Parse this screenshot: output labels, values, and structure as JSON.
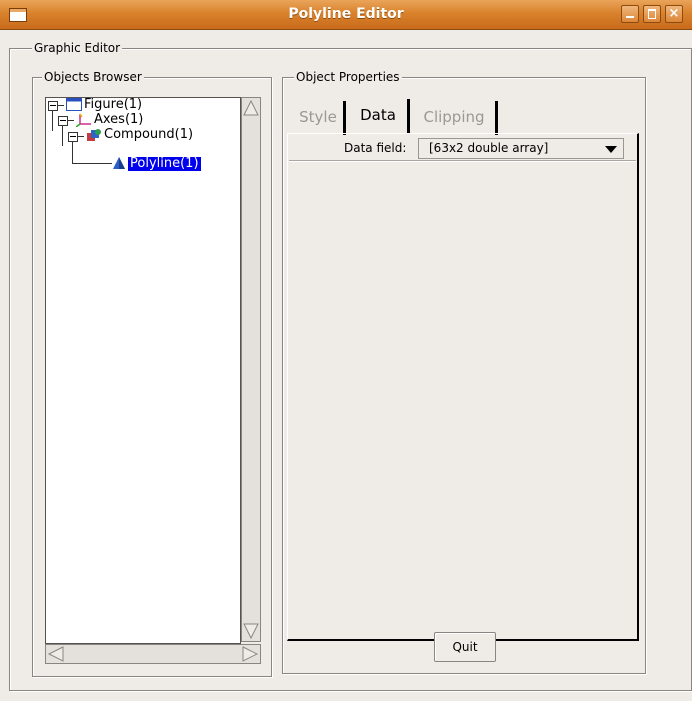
{
  "window": {
    "title": "Polyline Editor",
    "titlebar_color": "#d9822c"
  },
  "graphic_editor": {
    "label": "Graphic Editor"
  },
  "objects_browser": {
    "label": "Objects Browser",
    "tree": [
      {
        "label": "Figure(1)",
        "icon": "figure-icon"
      },
      {
        "label": "Axes(1)",
        "icon": "axes-icon"
      },
      {
        "label": "Compound(1)",
        "icon": "compound-icon"
      },
      {
        "label": "Polyline(1)",
        "icon": "polyline-icon",
        "selected": true
      }
    ],
    "selection_color": "#0000ee"
  },
  "object_properties": {
    "label": "Object Properties",
    "tabs": [
      {
        "label": "Style",
        "state": "inactive"
      },
      {
        "label": "Data",
        "state": "active"
      },
      {
        "label": "Clipping",
        "state": "inactive"
      }
    ],
    "data_field_label": "Data field:",
    "data_field_value": "[63x2 double array]",
    "quit_label": "Quit"
  }
}
